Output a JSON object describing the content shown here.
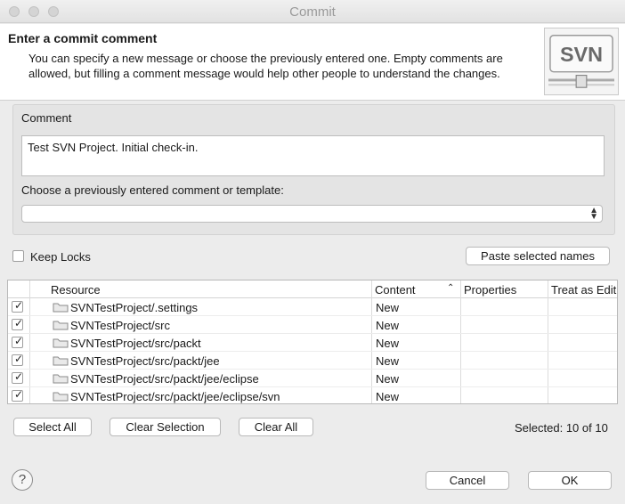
{
  "window": {
    "title": "Commit"
  },
  "header": {
    "title": "Enter a commit comment",
    "description": "You can specify a new message or choose the previously entered one. Empty comments are allowed, but filling a comment message would help other people to understand the changes.",
    "logo_text": "SVN"
  },
  "comment_group": {
    "title": "Comment",
    "comment_value": "Test SVN Project. Initial check-in.",
    "choose_label": "Choose a previously entered comment or template:",
    "template_value": ""
  },
  "keep_locks": {
    "label": "Keep Locks",
    "checked": false
  },
  "paste_button": "Paste selected names",
  "table": {
    "columns": [
      "Resource",
      "Content",
      "Properties",
      "Treat as Edit"
    ],
    "rows": [
      {
        "checked": true,
        "resource": "SVNTestProject/.settings",
        "content": "New"
      },
      {
        "checked": true,
        "resource": "SVNTestProject/src",
        "content": "New"
      },
      {
        "checked": true,
        "resource": "SVNTestProject/src/packt",
        "content": "New"
      },
      {
        "checked": true,
        "resource": "SVNTestProject/src/packt/jee",
        "content": "New"
      },
      {
        "checked": true,
        "resource": "SVNTestProject/src/packt/jee/eclipse",
        "content": "New"
      },
      {
        "checked": true,
        "resource": "SVNTestProject/src/packt/jee/eclipse/svn",
        "content": "New"
      }
    ]
  },
  "selection_buttons": {
    "select_all": "Select All",
    "clear_selection": "Clear Selection",
    "clear_all": "Clear All"
  },
  "selected_count": "Selected: 10 of 10",
  "footer": {
    "cancel": "Cancel",
    "ok": "OK"
  },
  "icons": {
    "help": "help-icon",
    "folder": "folder-icon",
    "sort": "sort-ascending-icon",
    "chevron": "select-chevron-icon"
  }
}
